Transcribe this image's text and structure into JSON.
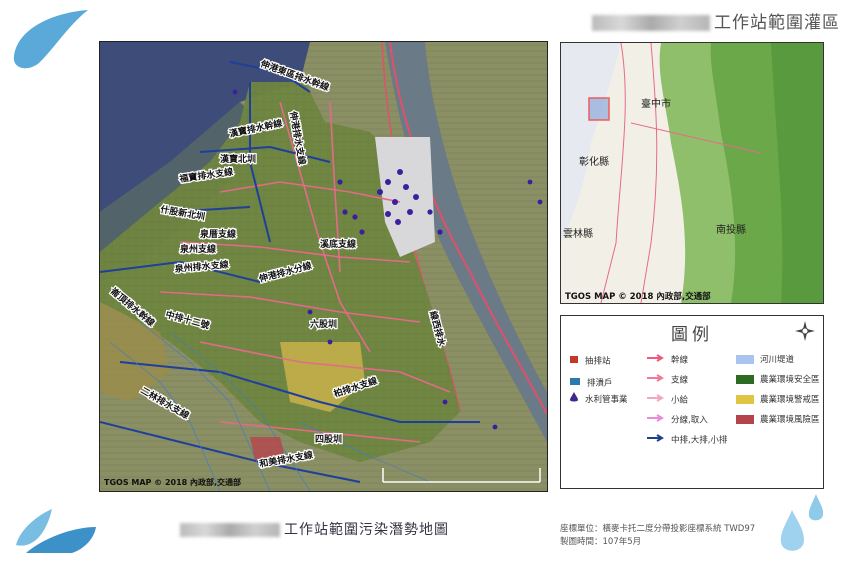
{
  "header": {
    "title_suffix": "工作站範圍灌區"
  },
  "footer": {
    "title_suffix": "工作站範圍污染潛勢地圖",
    "coord_line": "座標單位：橫麥卡托二度分帶投影座標系統 TWD97",
    "date_line": "製圖時間：107年5月"
  },
  "main_map": {
    "copyright": "TGOS MAP © 2018 內政部,交通部",
    "labels": [
      "伸港東區排水幹線",
      "伸港排水支線",
      "漢寶排水幹線",
      "漢寶北圳",
      "福寶排水支線",
      "什股新北圳",
      "泉州排水支線",
      "泉州支線",
      "泉厝支線",
      "溪底支線",
      "崙頂排水幹線",
      "伸港排水分線",
      "六股圳",
      "中排十二號",
      "柏排水支線",
      "和美排水支線",
      "四股圳",
      "二林排水支線",
      "線西排水"
    ]
  },
  "mini_map": {
    "copyright": "TGOS MAP © 2018 內政部,交通部",
    "places": [
      "臺中市",
      "彰化縣",
      "南投縣",
      "雲林縣"
    ]
  },
  "legend": {
    "title": "圖例",
    "items": [
      {
        "label": "抽排站",
        "symbol": "pump-station-icon",
        "color": "#c0392b"
      },
      {
        "label": "排潰戶",
        "symbol": "drain-household-icon",
        "color": "#2a7ab0"
      },
      {
        "label": "水利管事業",
        "symbol": "water-drop-icon",
        "color": "#3b2a8c"
      },
      {
        "label": "幹線",
        "symbol": "arrow",
        "color": "#ec5a7c"
      },
      {
        "label": "支線",
        "symbol": "arrow",
        "color": "#f07a9a"
      },
      {
        "label": "小給",
        "symbol": "arrow",
        "color": "#f3a6c0"
      },
      {
        "label": "分線,取入",
        "symbol": "arrow",
        "color": "#e98bd8"
      },
      {
        "label": "中排,大排,小排",
        "symbol": "arrow",
        "color": "#1f3f8a"
      },
      {
        "label": "河川堤道",
        "symbol": "swatch",
        "color": "#a9c4ee"
      },
      {
        "label": "農業環境安全區",
        "symbol": "swatch",
        "color": "#2e6b22"
      },
      {
        "label": "農業環境警戒區",
        "symbol": "swatch",
        "color": "#e0c640"
      },
      {
        "label": "農業環境風險區",
        "symbol": "swatch",
        "color": "#b5434c"
      }
    ]
  }
}
